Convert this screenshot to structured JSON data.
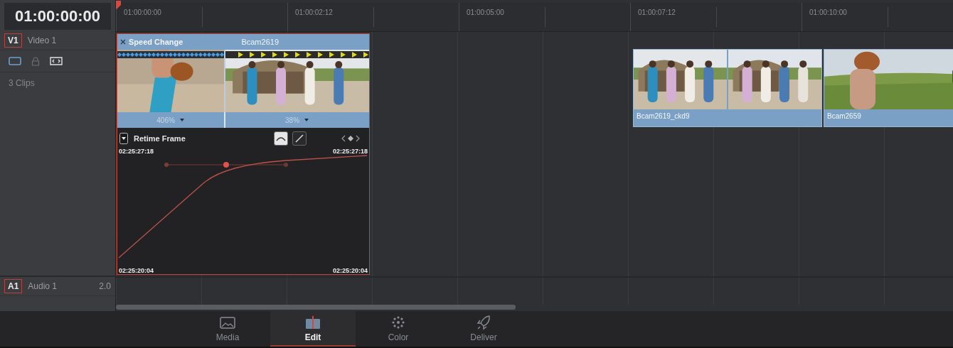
{
  "timecode": "01:00:00:00",
  "ruler": {
    "ticks": [
      "01:00:00:00",
      "01:00:02:12",
      "01:00:05:00",
      "01:00:07:12",
      "01:00:10:00"
    ]
  },
  "tracks": [
    {
      "kind": "video",
      "badge": "V1",
      "name": "Video 1",
      "status": "3 Clips"
    },
    {
      "kind": "audio",
      "badge": "A1",
      "name": "Audio 1",
      "channels": "2.0"
    }
  ],
  "speed_clip": {
    "title": "Speed Change",
    "clip_name": "Bcam2619",
    "selected": true,
    "segments": [
      {
        "kind": "ramp",
        "speed": "406%"
      },
      {
        "kind": "forward",
        "speed": "38%"
      }
    ],
    "retime": {
      "label": "Retime Frame",
      "curve_tools": [
        {
          "kind": "smooth",
          "selected": true
        },
        {
          "kind": "linear",
          "selected": false
        }
      ],
      "top_left": "02:25:27:18",
      "top_right": "02:25:27:18",
      "bottom_left": "02:25:20:04",
      "bottom_right": "02:25:20:04"
    }
  },
  "clips": [
    {
      "name": "Bcam2619_ckd9"
    },
    {
      "name": "Bcam2659"
    }
  ],
  "pages": [
    {
      "kind": "media",
      "label": "Media",
      "selected": false
    },
    {
      "kind": "edit",
      "label": "Edit",
      "selected": true
    },
    {
      "kind": "color",
      "label": "Color",
      "selected": false
    },
    {
      "kind": "deliver",
      "label": "Deliver",
      "selected": false
    }
  ]
}
